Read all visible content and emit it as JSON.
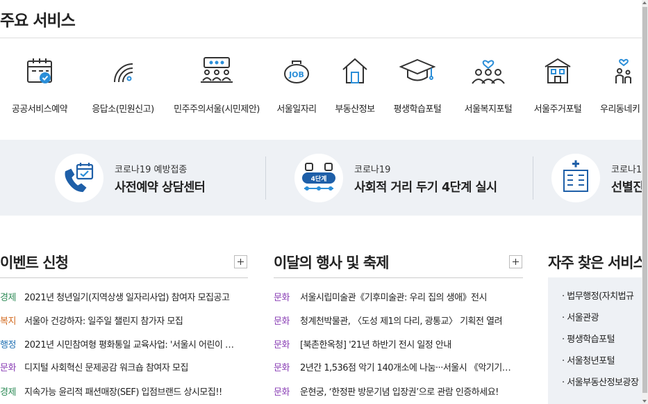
{
  "services": {
    "title": "주요 서비스",
    "items": [
      {
        "label": "공공서비스예약",
        "icon": "calendar-check-icon"
      },
      {
        "label": "응답소(민원신고)",
        "icon": "signal-waves-icon"
      },
      {
        "label": "민주주의서울(시민제안)",
        "icon": "meeting-speech-icon"
      },
      {
        "label": "서울일자리",
        "icon": "job-bag-icon"
      },
      {
        "label": "부동산정보",
        "icon": "house-icon"
      },
      {
        "label": "평생학습포털",
        "icon": "graduation-cap-icon"
      },
      {
        "label": "서울복지포털",
        "icon": "people-heart-icon"
      },
      {
        "label": "서울주거포털",
        "icon": "building-icon"
      },
      {
        "label": "우리동네키",
        "icon": "family-heart-icon"
      }
    ]
  },
  "banners": [
    {
      "sub": "코로나19 예방접종",
      "main": "사전예약 상담센터",
      "icon": "phone-calendar-icon"
    },
    {
      "sub": "코로나19",
      "main": "사회적 거리 두기 4단계 실시",
      "icon": "distancing-4-icon",
      "badge": "4단계"
    },
    {
      "sub": "코로나1",
      "main": "선별진",
      "icon": "hospital-icon"
    }
  ],
  "events": {
    "title": "이벤트 신청",
    "items": [
      {
        "cat": "경제",
        "color": "#2e8b57",
        "title": "2021년 청년일기(지역상생 일자리사업) 참여자 모집공고"
      },
      {
        "cat": "복지",
        "color": "#d2691e",
        "title": "서울아 건강하자: 일주일 챌린지 참가자 모집"
      },
      {
        "cat": "행정",
        "color": "#1f6fb2",
        "title": "2021년 시민참여형 평화통일 교육사업: '서울시 어린이 …"
      },
      {
        "cat": "문화",
        "color": "#8a3fb5",
        "title": "디지털 사회혁신 문제공감 워크숍 참여자 모집"
      },
      {
        "cat": "경제",
        "color": "#2e8b57",
        "title": "지속가능 윤리적 패션매장(SEF) 입점브랜드 상시모집!!"
      }
    ]
  },
  "festivals": {
    "title": "이달의 행사 및 축제",
    "items": [
      {
        "cat": "문화",
        "color": "#8a3fb5",
        "title": "서울시립미술관《기후미술관: 우리 집의 생애》전시"
      },
      {
        "cat": "문화",
        "color": "#8a3fb5",
        "title": "청계천박물관, 〈도성 제1의 다리, 광통교〉 기획전 열려"
      },
      {
        "cat": "문화",
        "color": "#8a3fb5",
        "title": "[북촌한옥청] '21년 하반기 전시 일정 안내"
      },
      {
        "cat": "문화",
        "color": "#8a3fb5",
        "title": "2년간 1,536점 악기 140개소에 나눔···서울시 《악기기…"
      },
      {
        "cat": "문화",
        "color": "#8a3fb5",
        "title": "운현궁, ‘한정판 방문기념 입장권’으로 관람 인증하세요!"
      }
    ]
  },
  "faq": {
    "title": "자주 찾은 서비스",
    "items": [
      "법무행정(자치법규",
      "서울관광",
      "평생학습포털",
      "서울청년포털",
      "서울부동산정보광장"
    ]
  }
}
